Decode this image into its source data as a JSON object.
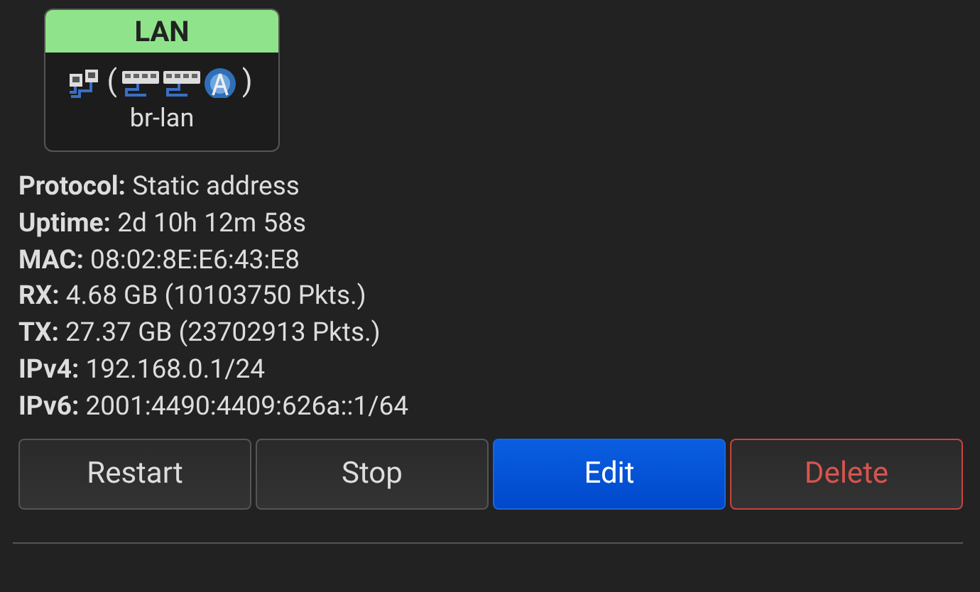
{
  "interface": {
    "title": "LAN",
    "device": "br-lan",
    "icons": [
      {
        "kind": "ethernet"
      },
      {
        "kind": "paren",
        "text": "("
      },
      {
        "kind": "switch"
      },
      {
        "kind": "switch"
      },
      {
        "kind": "wireless"
      },
      {
        "kind": "paren",
        "text": ")"
      }
    ]
  },
  "details": [
    {
      "label": "Protocol:",
      "value": "Static address"
    },
    {
      "label": "Uptime:",
      "value": "2d 10h 12m 58s"
    },
    {
      "label": "MAC:",
      "value": "08:02:8E:E6:43:E8"
    },
    {
      "label": "RX:",
      "value": "4.68 GB (10103750 Pkts.)"
    },
    {
      "label": "TX:",
      "value": "27.37 GB (23702913 Pkts.)"
    },
    {
      "label": "IPv4:",
      "value": "192.168.0.1/24"
    },
    {
      "label": "IPv6:",
      "value": "2001:4490:4409:626a::1/64"
    }
  ],
  "buttons": [
    {
      "label": "Restart",
      "kind": "default"
    },
    {
      "label": "Stop",
      "kind": "default"
    },
    {
      "label": "Edit",
      "kind": "primary"
    },
    {
      "label": "Delete",
      "kind": "danger"
    }
  ]
}
